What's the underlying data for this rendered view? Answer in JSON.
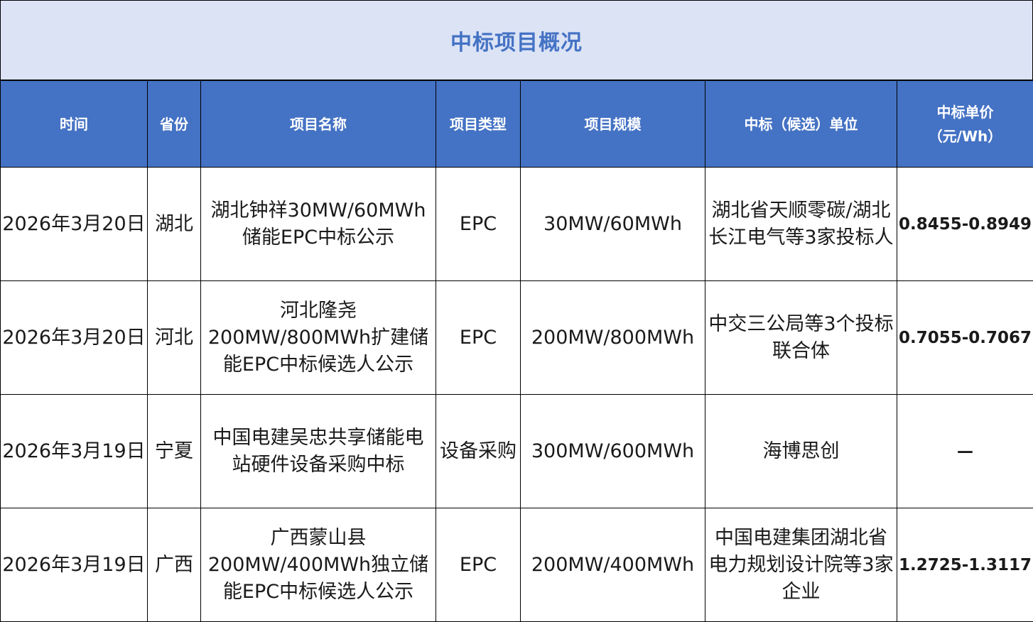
{
  "title": "中标项目概况",
  "columns": {
    "date": "时间",
    "province": "省份",
    "name": "项目名称",
    "type": "项目类型",
    "scale": "项目规模",
    "winner": "中标（候选）单位",
    "price": "中标单价\n（元/Wh）"
  },
  "rows": [
    {
      "date": "2026年3月20日",
      "province": "湖北",
      "name": "湖北钟祥30MW/60MWh储能EPC中标公示",
      "type": "EPC",
      "scale": "30MW/60MWh",
      "winner": "湖北省天顺零碳/湖北长江电气等3家投标人",
      "price": "0.8455-0.8949"
    },
    {
      "date": "2026年3月20日",
      "province": "河北",
      "name": "河北隆尧200MW/800MWh扩建储能EPC中标候选人公示",
      "type": "EPC",
      "scale": "200MW/800MWh",
      "winner": "中交三公局等3个投标联合体",
      "price": "0.7055-0.7067"
    },
    {
      "date": "2026年3月19日",
      "province": "宁夏",
      "name": "中国电建吴忠共享储能电站硬件设备采购中标",
      "type": "设备采购",
      "scale": "300MW/600MWh",
      "winner": "海博思创",
      "price": "—"
    },
    {
      "date": "2026年3月19日",
      "province": "广西",
      "name": "广西蒙山县200MW/400MWh独立储能EPC中标候选人公示",
      "type": "EPC",
      "scale": "200MW/400MWh",
      "winner": "中国电建集团湖北省电力规划设计院等3家企业",
      "price": "1.2725-1.3117"
    }
  ],
  "colors": {
    "title_bg": "#dbe3f5",
    "title_text": "#4472c4",
    "header_bg": "#4472c4",
    "header_text": "#ffffff",
    "grid_line": "#000000"
  },
  "chart_data": {
    "type": "table",
    "title": "中标项目概况",
    "columns": [
      "时间",
      "省份",
      "项目名称",
      "项目类型",
      "项目规模",
      "中标（候选）单位",
      "中标单价（元/Wh）"
    ],
    "rows": [
      [
        "2026年3月20日",
        "湖北",
        "湖北钟祥30MW/60MWh储能EPC中标公示",
        "EPC",
        "30MW/60MWh",
        "湖北省天顺零碳/湖北长江电气等3家投标人",
        "0.8455-0.8949"
      ],
      [
        "2026年3月20日",
        "河北",
        "河北隆尧200MW/800MWh扩建储能EPC中标候选人公示",
        "EPC",
        "200MW/800MWh",
        "中交三公局等3个投标联合体",
        "0.7055-0.7067"
      ],
      [
        "2026年3月19日",
        "宁夏",
        "中国电建吴忠共享储能电站硬件设备采购中标",
        "设备采购",
        "300MW/600MWh",
        "海博思创",
        "—"
      ],
      [
        "2026年3月19日",
        "广西",
        "广西蒙山县200MW/400MWh独立储能EPC中标候选人公示",
        "EPC",
        "200MW/400MWh",
        "中国电建集团湖北省电力规划设计院等3家企业",
        "1.2725-1.3117"
      ]
    ]
  }
}
